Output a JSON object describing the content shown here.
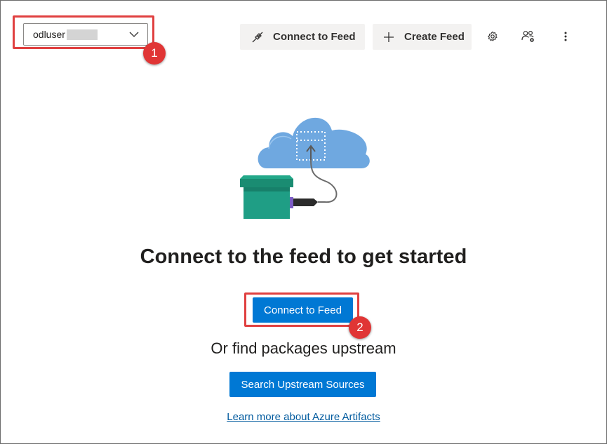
{
  "feed_selector": {
    "value": "odluser"
  },
  "toolbar": {
    "connect_label": "Connect to Feed",
    "create_label": "Create Feed",
    "connect_icon": "plug-icon",
    "create_icon": "plus-icon",
    "settings_icon": "gear-icon",
    "permissions_icon": "user-settings-icon",
    "more_icon": "more-vertical-icon"
  },
  "callouts": [
    "1",
    "2"
  ],
  "main": {
    "headline": "Connect to the feed to get started",
    "connect_button": "Connect to Feed",
    "subheading": "Or find packages upstream",
    "search_button": "Search Upstream Sources",
    "learn_link": "Learn more about Azure Artifacts"
  },
  "colors": {
    "accent": "#0078d4",
    "callout": "#e03535",
    "cloud": "#6fa8e0",
    "box": "#1f9e85"
  }
}
